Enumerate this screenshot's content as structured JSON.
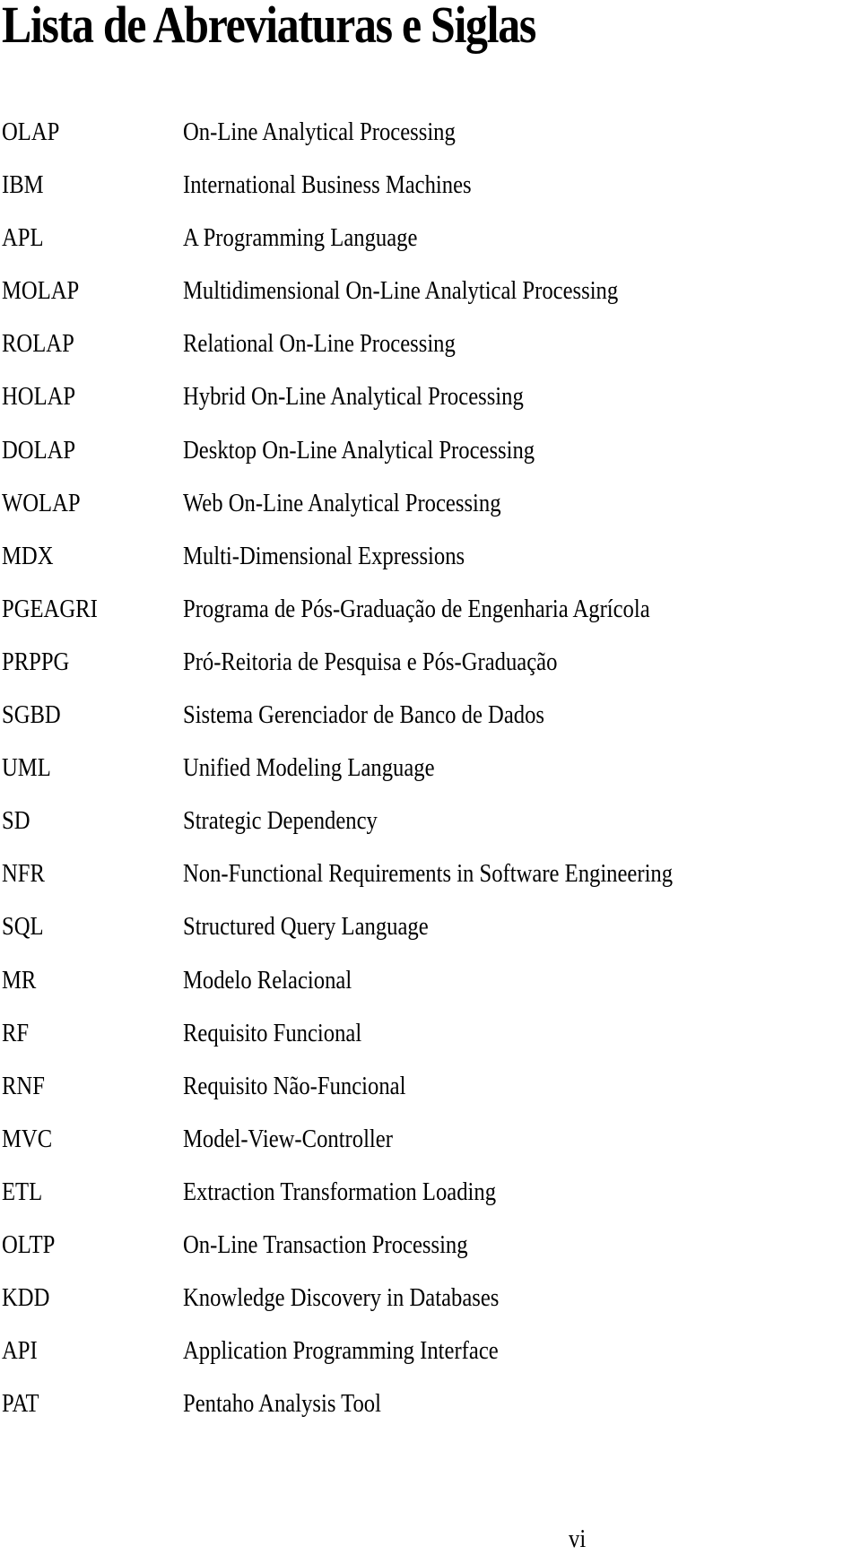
{
  "page": {
    "title": "Lista de Abreviaturas e Siglas",
    "page_number": "vi"
  },
  "abbreviations": [
    {
      "acronym": "OLAP",
      "meaning": "On-Line Analytical Processing"
    },
    {
      "acronym": "IBM",
      "meaning": "International Business Machines"
    },
    {
      "acronym": "APL",
      "meaning": "A Programming Language"
    },
    {
      "acronym": "MOLAP",
      "meaning": "Multidimensional On-Line Analytical Processing"
    },
    {
      "acronym": "ROLAP",
      "meaning": "Relational On-Line Processing"
    },
    {
      "acronym": "HOLAP",
      "meaning": "Hybrid On-Line Analytical Processing"
    },
    {
      "acronym": "DOLAP",
      "meaning": "Desktop On-Line Analytical Processing"
    },
    {
      "acronym": "WOLAP",
      "meaning": "Web On-Line Analytical Processing"
    },
    {
      "acronym": "MDX",
      "meaning": "Multi-Dimensional Expressions"
    },
    {
      "acronym": "PGEAGRI",
      "meaning": "Programa de Pós-Graduação de Engenharia Agrícola"
    },
    {
      "acronym": "PRPPG",
      "meaning": "Pró-Reitoria de Pesquisa e Pós-Graduação"
    },
    {
      "acronym": "SGBD",
      "meaning": "Sistema Gerenciador de Banco de Dados"
    },
    {
      "acronym": "UML",
      "meaning": "Unified Modeling Language"
    },
    {
      "acronym": "SD",
      "meaning": "Strategic Dependency"
    },
    {
      "acronym": "NFR",
      "meaning": "Non-Functional Requirements in Software Engineering"
    },
    {
      "acronym": "SQL",
      "meaning": "Structured Query Language"
    },
    {
      "acronym": "MR",
      "meaning": "Modelo Relacional"
    },
    {
      "acronym": "RF",
      "meaning": "Requisito Funcional"
    },
    {
      "acronym": "RNF",
      "meaning": "Requisito Não-Funcional"
    },
    {
      "acronym": "MVC",
      "meaning": "Model-View-Controller"
    },
    {
      "acronym": "ETL",
      "meaning": "Extraction Transformation Loading"
    },
    {
      "acronym": "OLTP",
      "meaning": "On-Line Transaction Processing"
    },
    {
      "acronym": "KDD",
      "meaning": "Knowledge Discovery in Databases"
    },
    {
      "acronym": "API",
      "meaning": "Application Programming Interface"
    },
    {
      "acronym": "PAT",
      "meaning": "Pentaho Analysis Tool"
    }
  ]
}
